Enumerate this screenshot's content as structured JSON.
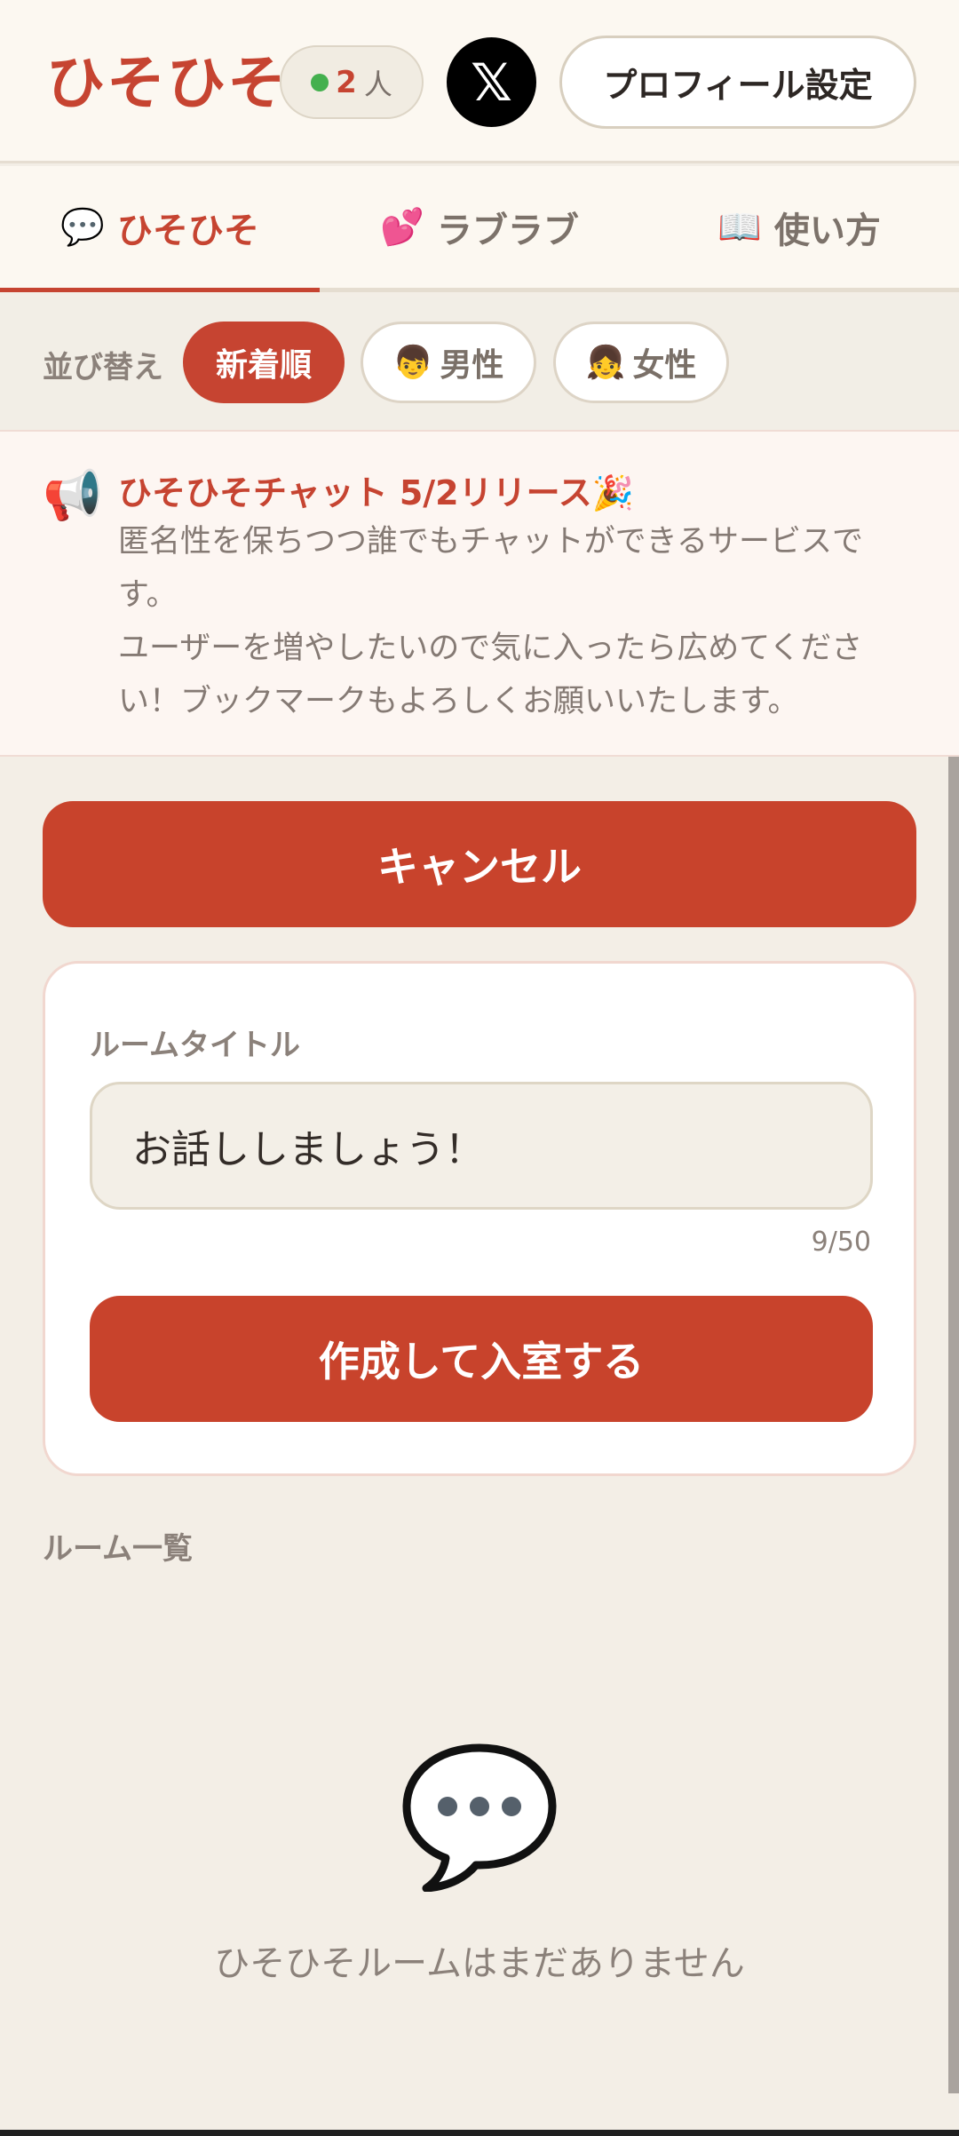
{
  "header": {
    "logo": "ひそひそ",
    "online_count": "2",
    "online_unit": "人",
    "x_icon": "𝕏",
    "profile_button": "プロフィール設定"
  },
  "tabs": [
    {
      "icon": "💬",
      "label": "ひそひそ",
      "active": true
    },
    {
      "icon": "💕",
      "label": "ラブラブ",
      "active": false
    },
    {
      "icon": "📖",
      "label": "使い方",
      "active": false
    }
  ],
  "sort": {
    "label": "並び替え",
    "options": [
      {
        "icon": "",
        "label": "新着順"
      },
      {
        "icon": "👦",
        "label": "男性"
      },
      {
        "icon": "👧",
        "label": "女性"
      }
    ]
  },
  "notice": {
    "icon": "📢",
    "title": "ひそひそチャット 5/2リリース🎉",
    "line1": "匿名性を保ちつつ誰でもチャットができるサービスです。",
    "line2": "ユーザーを増やしたいので気に入ったら広めてください！ブックマークもよろしくお願いいたします。"
  },
  "actions": {
    "cancel": "キャンセル"
  },
  "create_form": {
    "label": "ルームタイトル",
    "value": "お話ししましょう！",
    "char_count": "9/50",
    "submit": "作成して入室する"
  },
  "room_list": {
    "label": "ルーム一覧",
    "empty_text": "ひそひそルームはまだありません"
  },
  "colors": {
    "accent": "#c8432c",
    "background": "#f3eee6",
    "online": "#44b04e"
  }
}
